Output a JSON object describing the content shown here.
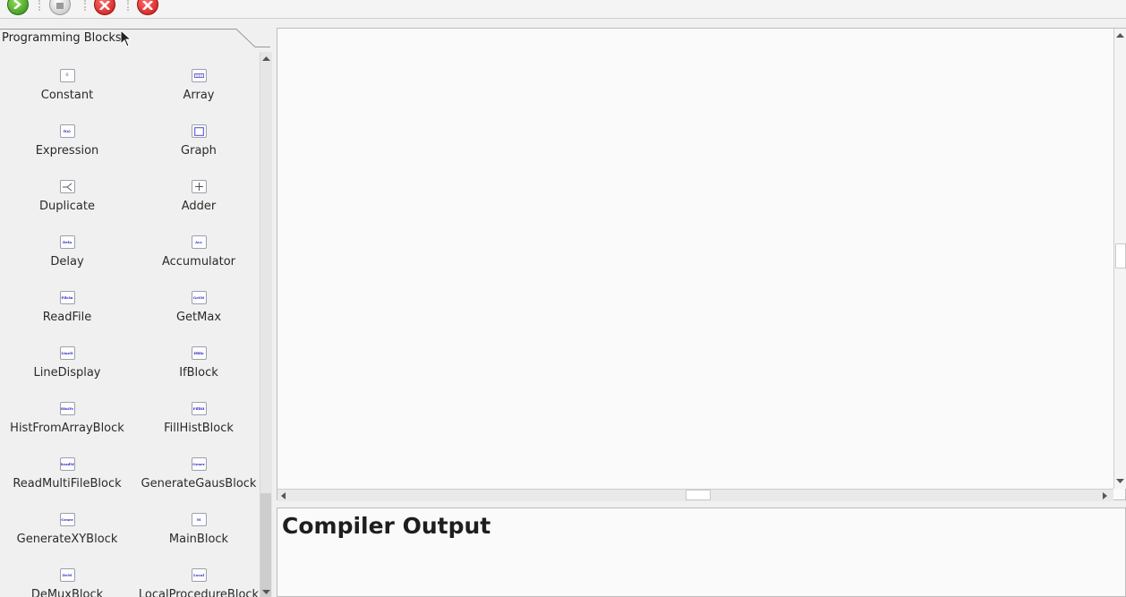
{
  "toolbar": {
    "buttons": [
      {
        "icon": "run-icon",
        "color": "#3b9a1c"
      },
      {
        "icon": "stop-icon",
        "color": "#b8b8b8"
      },
      {
        "icon": "close-icon",
        "color": "#d42020"
      },
      {
        "icon": "close-icon",
        "color": "#d42020"
      }
    ]
  },
  "palette": {
    "tab_title": "Programming Blocks",
    "blocks": [
      {
        "label": "Constant",
        "icon": "0"
      },
      {
        "label": "Array",
        "icon": "array-icon"
      },
      {
        "label": "Expression",
        "icon": "f(x)"
      },
      {
        "label": "Graph",
        "icon": "graph-icon"
      },
      {
        "label": "Duplicate",
        "icon": "duplicate-icon"
      },
      {
        "label": "Adder",
        "icon": "adder-icon"
      },
      {
        "label": "Delay",
        "icon": "Dela"
      },
      {
        "label": "Accumulator",
        "icon": "Acc"
      },
      {
        "label": "ReadFile",
        "icon": "FileIn"
      },
      {
        "label": "GetMax",
        "icon": "GetM"
      },
      {
        "label": "LineDisplay",
        "icon": "LineD"
      },
      {
        "label": "IfBlock",
        "icon": "IfBlo"
      },
      {
        "label": "HistFromArrayBlock",
        "icon": "HistFr"
      },
      {
        "label": "FillHistBlock",
        "icon": "FillHi"
      },
      {
        "label": "ReadMultiFileBlock",
        "icon": "ReadM"
      },
      {
        "label": "GenerateGausBlock",
        "icon": "Gener"
      },
      {
        "label": "GenerateXYBlock",
        "icon": "Gener"
      },
      {
        "label": "MainBlock",
        "icon": "M"
      },
      {
        "label": "DeMuxBlock",
        "icon": "DeM"
      },
      {
        "label": "LocalProcedureBlock",
        "icon": "Local"
      }
    ]
  },
  "output": {
    "title": "Compiler Output"
  },
  "colors": {
    "icon_text": "#2020c8",
    "panel_bg": "#f0f0f0",
    "canvas_bg": "#fafafa"
  }
}
